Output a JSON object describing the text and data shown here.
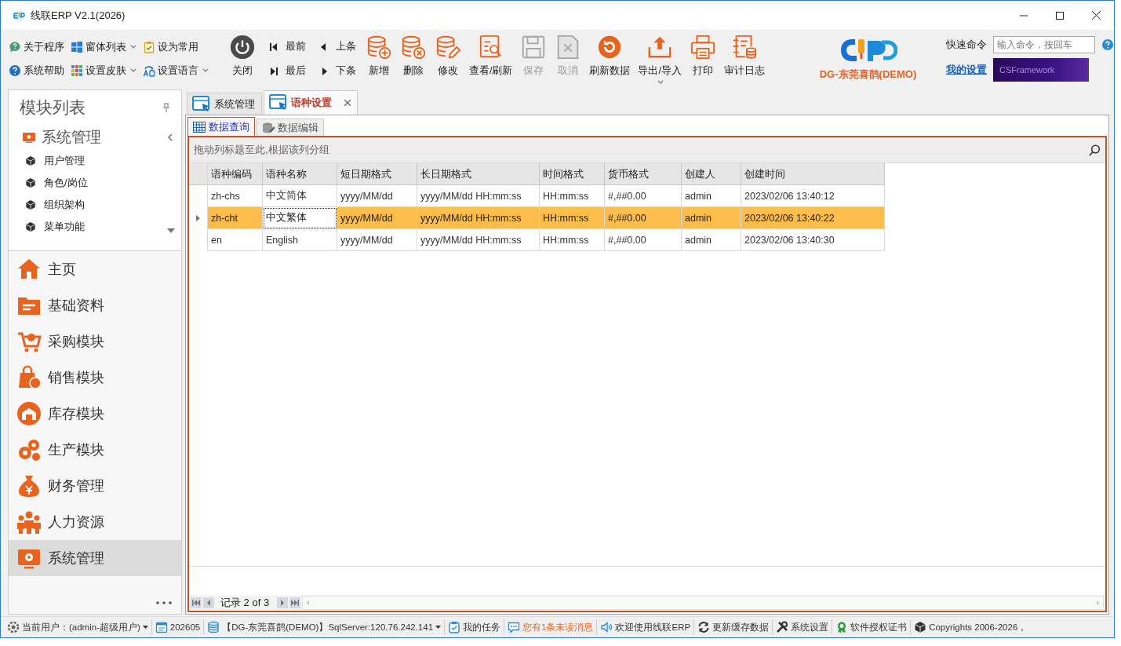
{
  "window": {
    "title": "线联ERP V2.1(2026)"
  },
  "toolbar": {
    "small_buttons": [
      {
        "label": "关于程序",
        "dropdown": false
      },
      {
        "label": "窗体列表",
        "dropdown": true
      },
      {
        "label": "设为常用",
        "dropdown": false
      },
      {
        "label": "系统帮助",
        "dropdown": false
      },
      {
        "label": "设置皮肤",
        "dropdown": true
      },
      {
        "label": "设置语言",
        "dropdown": true
      }
    ],
    "close_button": {
      "label": "关闭"
    },
    "nav_buttons": [
      {
        "label": "最前"
      },
      {
        "label": "上条"
      },
      {
        "label": "最后"
      },
      {
        "label": "下条"
      }
    ],
    "big_buttons": [
      {
        "label": "新增",
        "disabled": false,
        "dropdown": false
      },
      {
        "label": "删除",
        "disabled": false,
        "dropdown": false
      },
      {
        "label": "修改",
        "disabled": false,
        "dropdown": false
      },
      {
        "label": "查看/刷新",
        "disabled": false,
        "dropdown": false
      },
      {
        "label": "保存",
        "disabled": true,
        "dropdown": false
      },
      {
        "label": "取消",
        "disabled": true,
        "dropdown": false
      },
      {
        "label": "刷新数据",
        "disabled": false,
        "dropdown": false
      },
      {
        "label": "导出/导入",
        "disabled": false,
        "dropdown": true
      },
      {
        "label": "打印",
        "disabled": false,
        "dropdown": false
      },
      {
        "label": "审计日志",
        "disabled": false,
        "dropdown": false
      }
    ],
    "brand": {
      "caption": "DG-东莞喜鹊(DEMO)"
    },
    "quick_command": {
      "label": "快速命令",
      "placeholder": "输入命令，按回车"
    },
    "settings_link": "我的设置",
    "banner": {
      "text": "CSFramework"
    }
  },
  "sidebar": {
    "title": "模块列表",
    "group": {
      "label": "系统管理",
      "expanded": true,
      "children": [
        {
          "label": "用户管理"
        },
        {
          "label": "角色/岗位"
        },
        {
          "label": "组织架构"
        },
        {
          "label": "菜单功能"
        }
      ]
    },
    "modules": [
      {
        "label": "主页",
        "selected": false
      },
      {
        "label": "基础资料",
        "selected": false
      },
      {
        "label": "采购模块",
        "selected": false
      },
      {
        "label": "销售模块",
        "selected": false
      },
      {
        "label": "库存模块",
        "selected": false
      },
      {
        "label": "生产模块",
        "selected": false
      },
      {
        "label": "财务管理",
        "selected": false
      },
      {
        "label": "人力资源",
        "selected": false
      },
      {
        "label": "系统管理",
        "selected": true
      }
    ]
  },
  "tabs": [
    {
      "label": "系统管理",
      "selected": false,
      "closable": false
    },
    {
      "label": "语种设置",
      "selected": true,
      "closable": true
    }
  ],
  "subtabs": [
    {
      "label": "数据查询",
      "selected": true
    },
    {
      "label": "数据编辑",
      "selected": false
    }
  ],
  "grid": {
    "group_panel": "拖动列标题至此,根据该列分组",
    "columns": [
      "语种编码",
      "语种名称",
      "短日期格式",
      "长日期格式",
      "时间格式",
      "货币格式",
      "创建人",
      "创建时间"
    ],
    "rows": [
      {
        "selected": false,
        "cells": [
          {
            "text": "zh-chs",
            "focused": false
          },
          {
            "text": "中文简体",
            "focused": false
          },
          {
            "text": "yyyy/MM/dd",
            "focused": false
          },
          {
            "text": "yyyy/MM/dd HH:mm:ss",
            "focused": false
          },
          {
            "text": "HH:mm:ss",
            "focused": false
          },
          {
            "text": "#,##0.00",
            "focused": false
          },
          {
            "text": "admin",
            "focused": false
          },
          {
            "text": "2023/02/06 13:40:12",
            "focused": false
          }
        ]
      },
      {
        "selected": true,
        "cells": [
          {
            "text": "zh-cht",
            "focused": false
          },
          {
            "text": "中文繁体",
            "focused": true
          },
          {
            "text": "yyyy/MM/dd",
            "focused": false
          },
          {
            "text": "yyyy/MM/dd HH:mm:ss",
            "focused": false
          },
          {
            "text": "HH:mm:ss",
            "focused": false
          },
          {
            "text": "#,##0.00",
            "focused": false
          },
          {
            "text": "admin",
            "focused": false
          },
          {
            "text": "2023/02/06 13:40:22",
            "focused": false
          }
        ]
      },
      {
        "selected": false,
        "cells": [
          {
            "text": "en",
            "focused": false
          },
          {
            "text": "English",
            "focused": false
          },
          {
            "text": "yyyy/MM/dd",
            "focused": false
          },
          {
            "text": "yyyy/MM/dd HH:mm:ss",
            "focused": false
          },
          {
            "text": "HH:mm:ss",
            "focused": false
          },
          {
            "text": "#,##0.00",
            "focused": false
          },
          {
            "text": "admin",
            "focused": false
          },
          {
            "text": "2023/02/06 13:40:30",
            "focused": false
          }
        ]
      }
    ]
  },
  "pager": {
    "text": "记录 2 of 3"
  },
  "status_bar": [
    {
      "label": "当前用户：(admin-超级用户)",
      "dropdown": true,
      "highlighted": false
    },
    {
      "label": "202605",
      "dropdown": false,
      "highlighted": false
    },
    {
      "label": "【DG-东莞喜鹊(DEMO)】SqlServer:120.76.242.141",
      "dropdown": true,
      "highlighted": false
    },
    {
      "label": "我的任务",
      "dropdown": false,
      "highlighted": false
    },
    {
      "label": "您有1条未读消息",
      "dropdown": false,
      "highlighted": true
    },
    {
      "label": "欢迎使用线联ERP",
      "dropdown": false,
      "highlighted": false
    },
    {
      "label": "更新缓存数据",
      "dropdown": false,
      "highlighted": false
    },
    {
      "label": "系统设置",
      "dropdown": false,
      "highlighted": false
    },
    {
      "label": "软件授权证书",
      "dropdown": false,
      "highlighted": false
    },
    {
      "label": "Copyrights 2006-2026，",
      "dropdown": false,
      "highlighted": false
    }
  ]
}
